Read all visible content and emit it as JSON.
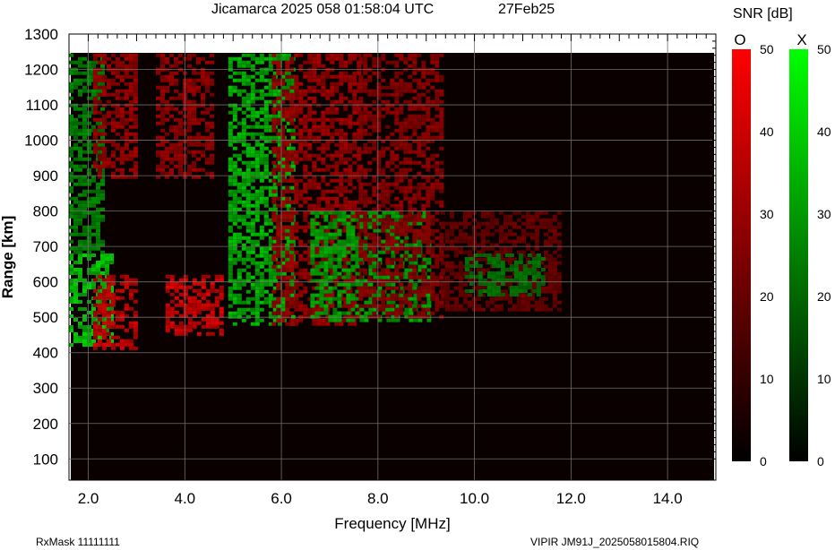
{
  "chart_data": {
    "type": "heatmap",
    "title": "Jicamarca 2025 058 01:58:04 UTC",
    "date_label": "27Feb25",
    "xlabel": "Frequency [MHz]",
    "ylabel": "Range [km]",
    "xlim": [
      1.6,
      15.0
    ],
    "ylim": [
      40,
      1300
    ],
    "data_range_max_km": 1245,
    "x_ticks": [
      2.0,
      4.0,
      6.0,
      8.0,
      10.0,
      12.0,
      14.0
    ],
    "x_tick_labels": [
      "2.0",
      "4.0",
      "6.0",
      "8.0",
      "10.0",
      "12.0",
      "14.0"
    ],
    "y_ticks": [
      100,
      200,
      300,
      400,
      500,
      600,
      700,
      800,
      900,
      1000,
      1100,
      1200,
      1300
    ],
    "y_tick_labels": [
      "100",
      "200",
      "300",
      "400",
      "500",
      "600",
      "700",
      "800",
      "900",
      "1000",
      "1100",
      "1200",
      "1300"
    ],
    "grid": true,
    "colorbar_title": "SNR [dB]",
    "colorbars": [
      {
        "label": "O",
        "color": "#ff0000",
        "range": [
          0,
          50
        ],
        "ticks": [
          0,
          10,
          20,
          30,
          40,
          50
        ]
      },
      {
        "label": "X",
        "color": "#00ff00",
        "range": [
          0,
          50
        ],
        "ticks": [
          0,
          10,
          20,
          30,
          40,
          50
        ]
      }
    ],
    "echo_regions": [
      {
        "mode": "X",
        "f_min": 1.6,
        "f_max": 2.5,
        "r_min": 420,
        "r_max": 680,
        "snr": 38
      },
      {
        "mode": "X",
        "f_min": 1.6,
        "f_max": 2.3,
        "r_min": 680,
        "r_max": 1245,
        "snr": 22
      },
      {
        "mode": "O",
        "f_min": 2.1,
        "f_max": 3.0,
        "r_min": 410,
        "r_max": 620,
        "snr": 40
      },
      {
        "mode": "O",
        "f_min": 2.1,
        "f_max": 3.0,
        "r_min": 900,
        "r_max": 1245,
        "snr": 28
      },
      {
        "mode": "O",
        "f_min": 3.6,
        "f_max": 4.8,
        "r_min": 450,
        "r_max": 620,
        "snr": 42
      },
      {
        "mode": "O",
        "f_min": 3.4,
        "f_max": 4.6,
        "r_min": 900,
        "r_max": 1245,
        "snr": 26
      },
      {
        "mode": "X",
        "f_min": 4.9,
        "f_max": 6.2,
        "r_min": 480,
        "r_max": 1245,
        "snr": 34
      },
      {
        "mode": "O",
        "f_min": 5.8,
        "f_max": 7.6,
        "r_min": 480,
        "r_max": 1245,
        "snr": 28
      },
      {
        "mode": "X",
        "f_min": 6.6,
        "f_max": 9.1,
        "r_min": 490,
        "r_max": 800,
        "snr": 30
      },
      {
        "mode": "O",
        "f_min": 7.6,
        "f_max": 9.3,
        "r_min": 500,
        "r_max": 1245,
        "snr": 24
      },
      {
        "mode": "O",
        "f_min": 9.3,
        "f_max": 11.8,
        "r_min": 520,
        "r_max": 800,
        "snr": 16
      },
      {
        "mode": "X",
        "f_min": 9.8,
        "f_max": 11.4,
        "r_min": 560,
        "r_max": 680,
        "snr": 18
      }
    ]
  },
  "footer": {
    "rx_mask": "RxMask 11111111",
    "file_info": "VIPIR  JM91J_2025058015804.RIQ"
  }
}
